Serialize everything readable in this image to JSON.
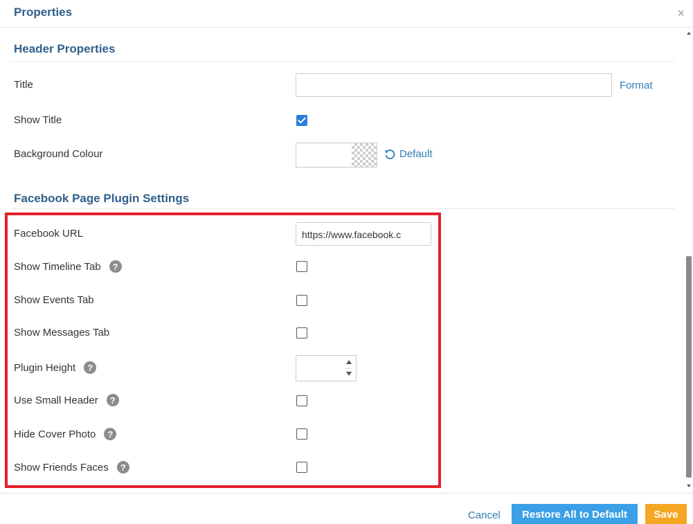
{
  "dialog": {
    "title": "Properties",
    "close_symbol": "×"
  },
  "header_section": {
    "title": "Header Properties",
    "title_label": "Title",
    "title_value": "",
    "format_link": "Format",
    "show_title_label": "Show Title",
    "show_title_checked": true,
    "background_label": "Background Colour",
    "default_link": "Default"
  },
  "facebook_section": {
    "title": "Facebook Page Plugin Settings",
    "url_label": "Facebook URL",
    "url_value": "https://www.facebook.c",
    "timeline_label": "Show Timeline Tab",
    "events_label": "Show Events Tab",
    "messages_label": "Show Messages Tab",
    "height_label": "Plugin Height",
    "small_header_label": "Use Small Header",
    "hide_cover_label": "Hide Cover Photo",
    "friends_faces_label": "Show Friends Faces",
    "help_glyph": "?"
  },
  "footer": {
    "cancel": "Cancel",
    "restore": "Restore All to Default",
    "save": "Save"
  },
  "colors": {
    "accent_blue": "#2f5f8a",
    "link_blue": "#2f7db5",
    "primary_button": "#3ba0e6",
    "save_button": "#f5a623",
    "highlight_red": "#e3202a",
    "checkbox_blue": "#2b7de0"
  }
}
